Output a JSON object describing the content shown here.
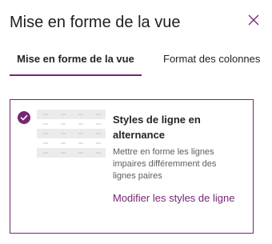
{
  "panel": {
    "title": "Mise en forme de la vue",
    "close_icon": "close-icon"
  },
  "tabs": [
    {
      "label": "Mise en forme de la vue",
      "active": true
    },
    {
      "label": "Format des colonnes",
      "active": false
    }
  ],
  "card": {
    "selected": true,
    "check_icon": "checkmark-circle-icon",
    "thumbnail_icon": "alternating-rows-icon",
    "title": "Styles de ligne en alternance",
    "description": "Mettre en forme les lignes impaires différemment des lignes paires",
    "link_label": "Modifier les styles de ligne"
  },
  "colors": {
    "accent": "#742774",
    "text": "#252423",
    "secondary_text": "#605e5c",
    "row_fill": "#edebe9"
  }
}
